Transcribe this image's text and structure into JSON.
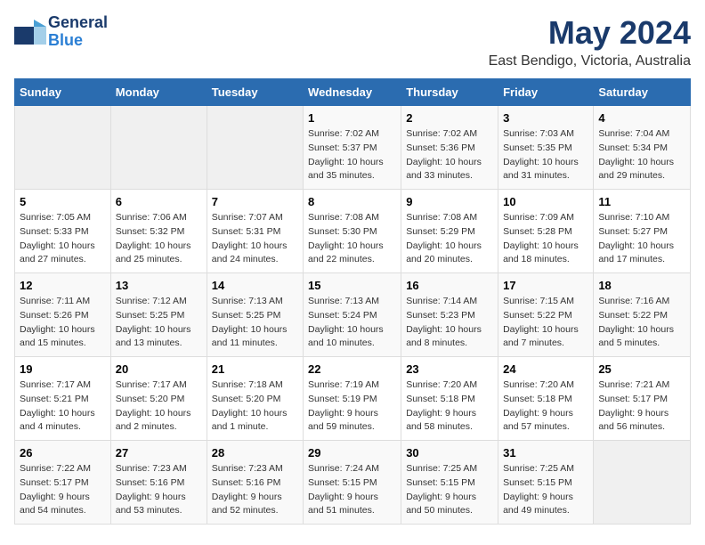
{
  "logo": {
    "text_general": "General",
    "text_blue": "Blue"
  },
  "title": "May 2024",
  "subtitle": "East Bendigo, Victoria, Australia",
  "days_of_week": [
    "Sunday",
    "Monday",
    "Tuesday",
    "Wednesday",
    "Thursday",
    "Friday",
    "Saturday"
  ],
  "weeks": [
    [
      {
        "day": "",
        "info": ""
      },
      {
        "day": "",
        "info": ""
      },
      {
        "day": "",
        "info": ""
      },
      {
        "day": "1",
        "info": "Sunrise: 7:02 AM\nSunset: 5:37 PM\nDaylight: 10 hours\nand 35 minutes."
      },
      {
        "day": "2",
        "info": "Sunrise: 7:02 AM\nSunset: 5:36 PM\nDaylight: 10 hours\nand 33 minutes."
      },
      {
        "day": "3",
        "info": "Sunrise: 7:03 AM\nSunset: 5:35 PM\nDaylight: 10 hours\nand 31 minutes."
      },
      {
        "day": "4",
        "info": "Sunrise: 7:04 AM\nSunset: 5:34 PM\nDaylight: 10 hours\nand 29 minutes."
      }
    ],
    [
      {
        "day": "5",
        "info": "Sunrise: 7:05 AM\nSunset: 5:33 PM\nDaylight: 10 hours\nand 27 minutes."
      },
      {
        "day": "6",
        "info": "Sunrise: 7:06 AM\nSunset: 5:32 PM\nDaylight: 10 hours\nand 25 minutes."
      },
      {
        "day": "7",
        "info": "Sunrise: 7:07 AM\nSunset: 5:31 PM\nDaylight: 10 hours\nand 24 minutes."
      },
      {
        "day": "8",
        "info": "Sunrise: 7:08 AM\nSunset: 5:30 PM\nDaylight: 10 hours\nand 22 minutes."
      },
      {
        "day": "9",
        "info": "Sunrise: 7:08 AM\nSunset: 5:29 PM\nDaylight: 10 hours\nand 20 minutes."
      },
      {
        "day": "10",
        "info": "Sunrise: 7:09 AM\nSunset: 5:28 PM\nDaylight: 10 hours\nand 18 minutes."
      },
      {
        "day": "11",
        "info": "Sunrise: 7:10 AM\nSunset: 5:27 PM\nDaylight: 10 hours\nand 17 minutes."
      }
    ],
    [
      {
        "day": "12",
        "info": "Sunrise: 7:11 AM\nSunset: 5:26 PM\nDaylight: 10 hours\nand 15 minutes."
      },
      {
        "day": "13",
        "info": "Sunrise: 7:12 AM\nSunset: 5:25 PM\nDaylight: 10 hours\nand 13 minutes."
      },
      {
        "day": "14",
        "info": "Sunrise: 7:13 AM\nSunset: 5:25 PM\nDaylight: 10 hours\nand 11 minutes."
      },
      {
        "day": "15",
        "info": "Sunrise: 7:13 AM\nSunset: 5:24 PM\nDaylight: 10 hours\nand 10 minutes."
      },
      {
        "day": "16",
        "info": "Sunrise: 7:14 AM\nSunset: 5:23 PM\nDaylight: 10 hours\nand 8 minutes."
      },
      {
        "day": "17",
        "info": "Sunrise: 7:15 AM\nSunset: 5:22 PM\nDaylight: 10 hours\nand 7 minutes."
      },
      {
        "day": "18",
        "info": "Sunrise: 7:16 AM\nSunset: 5:22 PM\nDaylight: 10 hours\nand 5 minutes."
      }
    ],
    [
      {
        "day": "19",
        "info": "Sunrise: 7:17 AM\nSunset: 5:21 PM\nDaylight: 10 hours\nand 4 minutes."
      },
      {
        "day": "20",
        "info": "Sunrise: 7:17 AM\nSunset: 5:20 PM\nDaylight: 10 hours\nand 2 minutes."
      },
      {
        "day": "21",
        "info": "Sunrise: 7:18 AM\nSunset: 5:20 PM\nDaylight: 10 hours\nand 1 minute."
      },
      {
        "day": "22",
        "info": "Sunrise: 7:19 AM\nSunset: 5:19 PM\nDaylight: 9 hours\nand 59 minutes."
      },
      {
        "day": "23",
        "info": "Sunrise: 7:20 AM\nSunset: 5:18 PM\nDaylight: 9 hours\nand 58 minutes."
      },
      {
        "day": "24",
        "info": "Sunrise: 7:20 AM\nSunset: 5:18 PM\nDaylight: 9 hours\nand 57 minutes."
      },
      {
        "day": "25",
        "info": "Sunrise: 7:21 AM\nSunset: 5:17 PM\nDaylight: 9 hours\nand 56 minutes."
      }
    ],
    [
      {
        "day": "26",
        "info": "Sunrise: 7:22 AM\nSunset: 5:17 PM\nDaylight: 9 hours\nand 54 minutes."
      },
      {
        "day": "27",
        "info": "Sunrise: 7:23 AM\nSunset: 5:16 PM\nDaylight: 9 hours\nand 53 minutes."
      },
      {
        "day": "28",
        "info": "Sunrise: 7:23 AM\nSunset: 5:16 PM\nDaylight: 9 hours\nand 52 minutes."
      },
      {
        "day": "29",
        "info": "Sunrise: 7:24 AM\nSunset: 5:15 PM\nDaylight: 9 hours\nand 51 minutes."
      },
      {
        "day": "30",
        "info": "Sunrise: 7:25 AM\nSunset: 5:15 PM\nDaylight: 9 hours\nand 50 minutes."
      },
      {
        "day": "31",
        "info": "Sunrise: 7:25 AM\nSunset: 5:15 PM\nDaylight: 9 hours\nand 49 minutes."
      },
      {
        "day": "",
        "info": ""
      }
    ]
  ]
}
